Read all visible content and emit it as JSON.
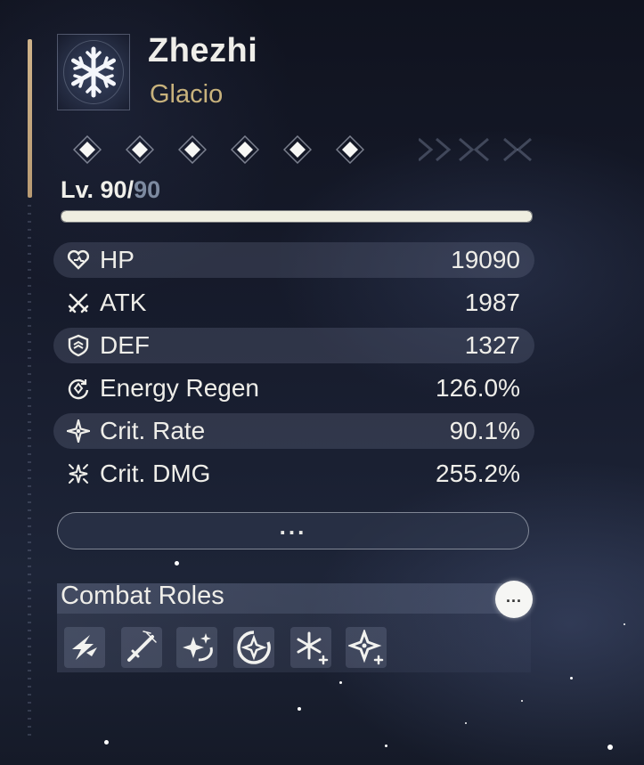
{
  "character": {
    "name": "Zhezhi",
    "element": "Glacio",
    "element_icon": "snowflake-icon",
    "accent_color": "#c8b27c"
  },
  "sequence": {
    "nodes": [
      "diamond-icon",
      "diamond-icon",
      "diamond-icon",
      "diamond-icon",
      "diamond-icon",
      "diamond-icon"
    ]
  },
  "level": {
    "prefix": "Lv. ",
    "current": "90",
    "separator": "/",
    "max": "90",
    "progress_fraction": 1.0
  },
  "stats": [
    {
      "label": "HP",
      "value": "19090",
      "icon": "heart-icon"
    },
    {
      "label": "ATK",
      "value": "1987",
      "icon": "crossed-swords-icon"
    },
    {
      "label": "DEF",
      "value": "1327",
      "icon": "shield-icon"
    },
    {
      "label": "Energy Regen",
      "value": "126.0%",
      "icon": "energy-regen-icon"
    },
    {
      "label": "Crit. Rate",
      "value": "90.1%",
      "icon": "crit-rate-icon"
    },
    {
      "label": "Crit. DMG",
      "value": "255.2%",
      "icon": "crit-dmg-icon"
    }
  ],
  "more_button": {
    "label": "..."
  },
  "combat_roles": {
    "title": "Combat Roles",
    "info_button": "...",
    "icons": [
      "lightning-icon",
      "sword-icon",
      "sparkle-swirl-icon",
      "star-circle-icon",
      "snowflake-plus-icon",
      "star-plus-icon"
    ]
  }
}
